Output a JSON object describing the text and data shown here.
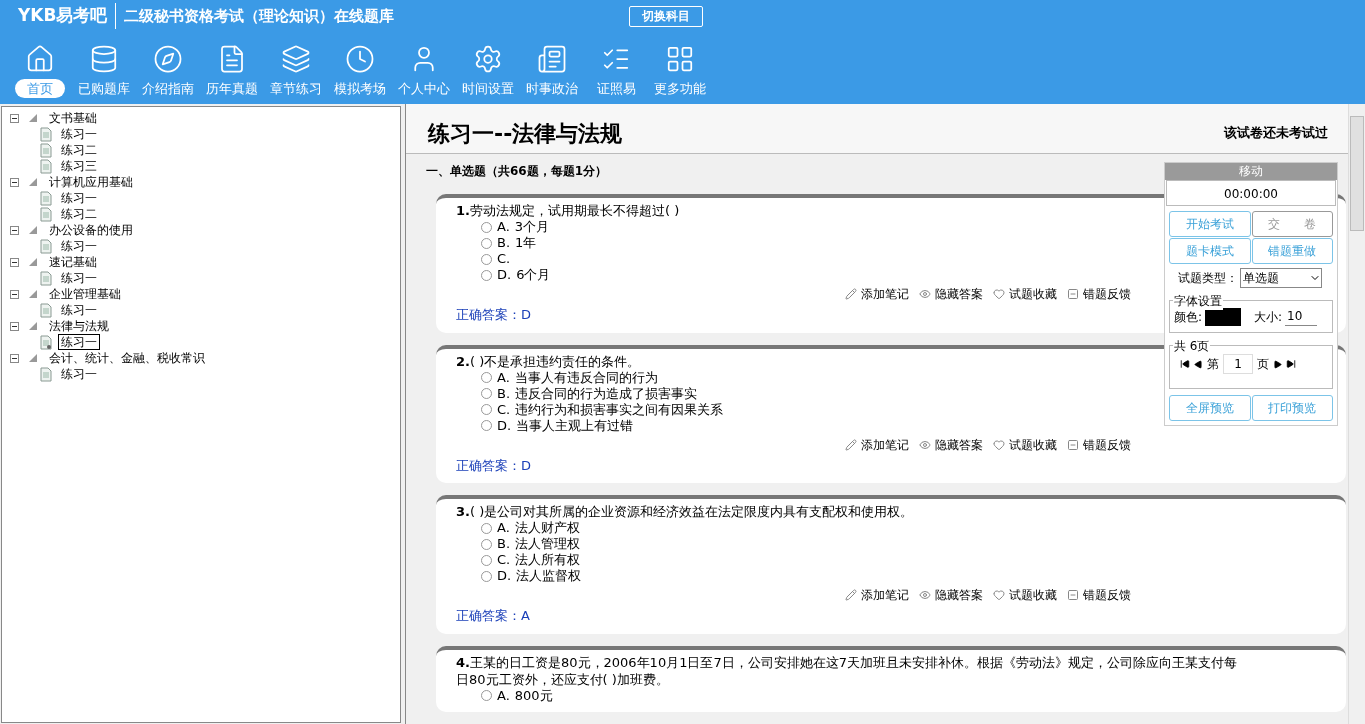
{
  "header": {
    "logo": "YKB易考吧",
    "title": "二级秘书资格考试（理论知识）在线题库",
    "switch_button": "切换科目"
  },
  "nav": [
    {
      "kind": "home",
      "label": "首页",
      "selected": true
    },
    {
      "kind": "database",
      "label": "已购题库",
      "selected": false
    },
    {
      "kind": "compass",
      "label": "介绍指南",
      "selected": false
    },
    {
      "kind": "paper",
      "label": "历年真题",
      "selected": false
    },
    {
      "kind": "layers",
      "label": "章节练习",
      "selected": false
    },
    {
      "kind": "clock",
      "label": "模拟考场",
      "selected": false
    },
    {
      "kind": "user",
      "label": "个人中心",
      "selected": false
    },
    {
      "kind": "gear",
      "label": "时间设置",
      "selected": false
    },
    {
      "kind": "news",
      "label": "时事政治",
      "selected": false
    },
    {
      "kind": "list",
      "label": "证照易",
      "selected": false
    },
    {
      "kind": "grid",
      "label": "更多功能",
      "selected": false
    }
  ],
  "tree": [
    {
      "label": "文书基础",
      "expanded": true,
      "children": [
        {
          "label": "练习一",
          "selected": false
        },
        {
          "label": "练习二",
          "selected": false
        },
        {
          "label": "练习三",
          "selected": false
        }
      ]
    },
    {
      "label": "计算机应用基础",
      "expanded": true,
      "children": [
        {
          "label": "练习一",
          "selected": false
        },
        {
          "label": "练习二",
          "selected": false
        }
      ]
    },
    {
      "label": "办公设备的使用",
      "expanded": true,
      "children": [
        {
          "label": "练习一",
          "selected": false
        }
      ]
    },
    {
      "label": "速记基础",
      "expanded": true,
      "children": [
        {
          "label": "练习一",
          "selected": false
        }
      ]
    },
    {
      "label": "企业管理基础",
      "expanded": true,
      "children": [
        {
          "label": "练习一",
          "selected": false
        }
      ]
    },
    {
      "label": "法律与法规",
      "expanded": true,
      "children": [
        {
          "label": "练习一",
          "selected": true
        }
      ]
    },
    {
      "label": "会计、统计、金融、税收常识",
      "expanded": true,
      "children": [
        {
          "label": "练习一",
          "selected": false
        }
      ]
    }
  ],
  "exam": {
    "title": "练习一--法律与法规",
    "status": "该试卷还未考试过",
    "section": "一、单选题（共66题，每题1分）",
    "questions": [
      {
        "number": "1.",
        "text": "劳动法规定，试用期最长不得超过( )",
        "options": [
          {
            "label": "A.",
            "text": "3个月",
            "selected": false
          },
          {
            "label": "B.",
            "text": "1年",
            "selected": false
          },
          {
            "label": "C.",
            "selected": false
          },
          {
            "label": "D.",
            "text": "6个月",
            "selected": false
          }
        ],
        "actions": [
          "添加笔记",
          "隐藏答案",
          "试题收藏",
          "错题反馈"
        ],
        "answer": "正确答案：D"
      },
      {
        "number": "2.",
        "text": "( )不是承担违约责任的条件。",
        "options": [
          {
            "label": "A.",
            "text": "当事人有违反合同的行为",
            "selected": false
          },
          {
            "label": "B.",
            "text": "违反合同的行为造成了损害事实",
            "selected": false
          },
          {
            "label": "C.",
            "text": "违约行为和损害事实之间有因果关系",
            "selected": false
          },
          {
            "label": "D.",
            "text": "当事人主观上有过错",
            "selected": false
          }
        ],
        "actions": [
          "添加笔记",
          "隐藏答案",
          "试题收藏",
          "错题反馈"
        ],
        "answer": "正确答案：D"
      },
      {
        "number": "3.",
        "text": "( )是公司对其所属的企业资源和经济效益在法定限度内具有支配权和使用权。",
        "options": [
          {
            "label": "A.",
            "text": "法人财产权",
            "selected": false
          },
          {
            "label": "B.",
            "text": "法人管理权",
            "selected": false
          },
          {
            "label": "C.",
            "text": "法人所有权",
            "selected": false
          },
          {
            "label": "D.",
            "text": "法人监督权",
            "selected": false
          }
        ],
        "actions": [
          "添加笔记",
          "隐藏答案",
          "试题收藏",
          "错题反馈"
        ],
        "answer": "正确答案：A"
      },
      {
        "number": "4.",
        "text": "王某的日工资是80元，2006年10月1日至7日，公司安排她在这7天加班且未安排补休。根据《劳动法》规定，公司除应向王某支付每日80元工资外，还应支付( )加班费。",
        "options": [
          {
            "label": "A.",
            "text": "800元",
            "selected": false
          }
        ]
      }
    ]
  },
  "panel": {
    "header": "移动",
    "timer": "00:00:00",
    "buttons": [
      {
        "label": "开始考试",
        "disabled": false
      },
      {
        "label": "交　　卷",
        "disabled": true
      },
      {
        "label": "题卡模式",
        "disabled": false
      },
      {
        "label": "错题重做",
        "disabled": false
      }
    ],
    "type_label": "试题类型：",
    "type_value": "单选题",
    "font_legend": "字体设置",
    "color_label": "颜色:",
    "color": "#000000",
    "size_label": "大小:",
    "size_value": "10",
    "pages_legend": "共 6页",
    "page_prefix": "第",
    "page_value": "1",
    "page_suffix": "页",
    "bottom_buttons": [
      "全屏预览",
      "打印预览"
    ]
  }
}
